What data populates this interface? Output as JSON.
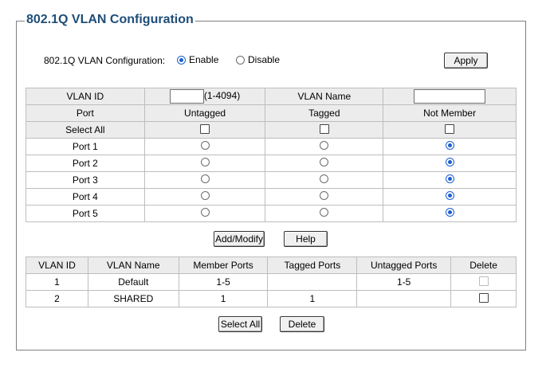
{
  "legend": "802.1Q VLAN Configuration",
  "config": {
    "label": "802.1Q VLAN Configuration:",
    "enable_label": "Enable",
    "disable_label": "Disable",
    "selected": "Enable",
    "apply_label": "Apply"
  },
  "vlan_form": {
    "vlan_id_label": "VLAN ID",
    "vlan_id_value": "",
    "vlan_id_range": "(1-4094)",
    "vlan_name_label": "VLAN Name",
    "vlan_name_value": "",
    "headers": {
      "port": "Port",
      "untagged": "Untagged",
      "tagged": "Tagged",
      "not_member": "Not Member"
    },
    "select_all_label": "Select All",
    "ports": [
      {
        "name": "Port 1",
        "selection": "Not Member"
      },
      {
        "name": "Port 2",
        "selection": "Not Member"
      },
      {
        "name": "Port 3",
        "selection": "Not Member"
      },
      {
        "name": "Port 4",
        "selection": "Not Member"
      },
      {
        "name": "Port 5",
        "selection": "Not Member"
      }
    ],
    "add_modify_label": "Add/Modify",
    "help_label": "Help"
  },
  "vlan_table": {
    "headers": {
      "vlan_id": "VLAN ID",
      "vlan_name": "VLAN Name",
      "member_ports": "Member Ports",
      "tagged_ports": "Tagged Ports",
      "untagged_ports": "Untagged Ports",
      "delete": "Delete"
    },
    "rows": [
      {
        "vlan_id": "1",
        "vlan_name": "Default",
        "member_ports": "1-5",
        "tagged_ports": "",
        "untagged_ports": "1-5",
        "delete_enabled": "false"
      },
      {
        "vlan_id": "2",
        "vlan_name": "SHARED",
        "member_ports": "1",
        "tagged_ports": "1",
        "untagged_ports": "",
        "delete_enabled": "true"
      }
    ],
    "select_all_label": "Select All",
    "delete_label": "Delete"
  },
  "colors": {
    "legend": "#1f4e79",
    "radio_selected": "#1a5fd0",
    "header_bg": "#ececec"
  }
}
